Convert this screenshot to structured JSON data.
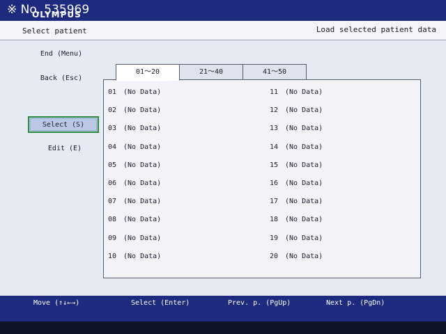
{
  "overlay": {
    "watermark": "※ No. 535969",
    "brand": "OLYMPUS"
  },
  "header": {
    "title_left": "Select patient",
    "title_right": "Load selected patient data"
  },
  "sidebar": {
    "end_label": "End (Menu)",
    "back_label": "Back (Esc)",
    "select_label": "Select (S)",
    "edit_label": "Edit (E)"
  },
  "tabs": [
    {
      "label": "01～20",
      "active": true
    },
    {
      "label": "21～40",
      "active": false
    },
    {
      "label": "41～50",
      "active": false
    }
  ],
  "patients_left": [
    {
      "num": "01",
      "text": "(No Data)"
    },
    {
      "num": "02",
      "text": "(No Data)"
    },
    {
      "num": "03",
      "text": "(No Data)"
    },
    {
      "num": "04",
      "text": "(No Data)"
    },
    {
      "num": "05",
      "text": "(No Data)"
    },
    {
      "num": "06",
      "text": "(No Data)"
    },
    {
      "num": "07",
      "text": "(No Data)"
    },
    {
      "num": "08",
      "text": "(No Data)"
    },
    {
      "num": "09",
      "text": "(No Data)"
    },
    {
      "num": "10",
      "text": "(No Data)"
    }
  ],
  "patients_right": [
    {
      "num": "11",
      "text": "(No Data)"
    },
    {
      "num": "12",
      "text": "(No Data)"
    },
    {
      "num": "13",
      "text": "(No Data)"
    },
    {
      "num": "14",
      "text": "(No Data)"
    },
    {
      "num": "15",
      "text": "(No Data)"
    },
    {
      "num": "16",
      "text": "(No Data)"
    },
    {
      "num": "17",
      "text": "(No Data)"
    },
    {
      "num": "18",
      "text": "(No Data)"
    },
    {
      "num": "19",
      "text": "(No Data)"
    },
    {
      "num": "20",
      "text": "(No Data)"
    }
  ],
  "footer": {
    "move": "Move (↑↓←→)",
    "select": "Select (Enter)",
    "prev": "Prev. p. (PgUp)",
    "next": "Next p. (PgDn)"
  },
  "colors": {
    "bar_blue": "#1d2a7e",
    "select_border": "#2e8a3c",
    "select_fill": "#b9c9e4"
  }
}
